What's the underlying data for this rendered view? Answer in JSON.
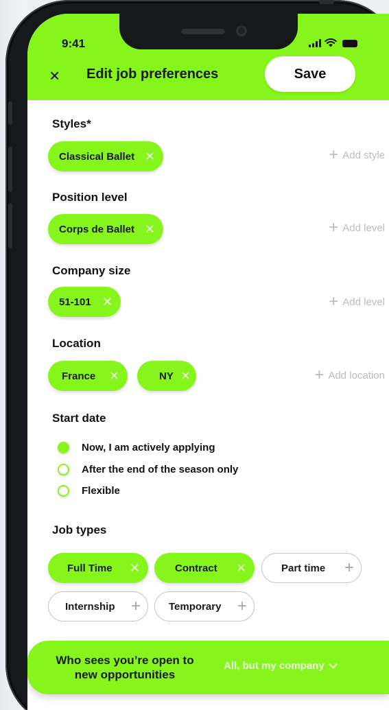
{
  "status_bar": {
    "time": "9:41"
  },
  "header": {
    "title": "Edit job preferences",
    "save_label": "Save",
    "close_icon": "close-icon"
  },
  "sections": {
    "styles": {
      "label": "Styles*",
      "chips": [
        "Classical Ballet"
      ],
      "add_label": "Add style"
    },
    "position_level": {
      "label": "Position level",
      "chips": [
        "Corps de Ballet"
      ],
      "add_label": "Add level"
    },
    "company_size": {
      "label": "Company size",
      "chips": [
        "51-101"
      ],
      "add_label": "Add level"
    },
    "location": {
      "label": "Location",
      "chips": [
        "France",
        "NY"
      ],
      "add_label": "Add location"
    },
    "start_date": {
      "label": "Start date",
      "options": [
        {
          "label": "Now, I am actively applying",
          "selected": true
        },
        {
          "label": "After the end of the season only",
          "selected": false
        },
        {
          "label": "Flexible",
          "selected": false
        }
      ]
    },
    "job_types": {
      "label": "Job types",
      "selected": [
        "Full Time",
        "Contract"
      ],
      "unselected": [
        "Part time",
        "Internship",
        "Temporary"
      ]
    }
  },
  "visibility": {
    "label": "Who sees you’re open to new opportunities",
    "value": "All, but my company"
  },
  "colors": {
    "accent": "#86f51c",
    "muted": "#b9bcc1",
    "text": "#111111"
  }
}
